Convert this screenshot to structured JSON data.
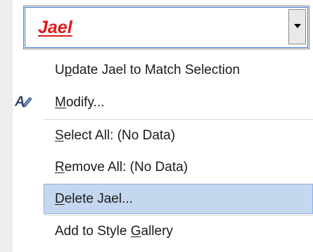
{
  "style_box": {
    "current_style": "Jael"
  },
  "menu": {
    "items": [
      {
        "pre": "U",
        "ul": "p",
        "post": "date Jael to Match Selection"
      },
      {
        "pre": "",
        "ul": "M",
        "post": "odify..."
      },
      {
        "pre": "",
        "ul": "S",
        "post": "elect All: (No Data)"
      },
      {
        "pre": "",
        "ul": "R",
        "post": "emove All: (No Data)"
      },
      {
        "pre": "",
        "ul": "D",
        "post": "elete Jael..."
      },
      {
        "pre": "Add to Style ",
        "ul": "G",
        "post": "allery"
      }
    ]
  },
  "icons": {
    "modify": "modify-style-pen-icon",
    "dropdown": "chevron-down-icon"
  },
  "colors": {
    "style_text": "#e01b1b",
    "highlight_fill": "#c5d7ef",
    "highlight_border": "#8fb1e2",
    "combo_border": "#3f7ad8"
  }
}
